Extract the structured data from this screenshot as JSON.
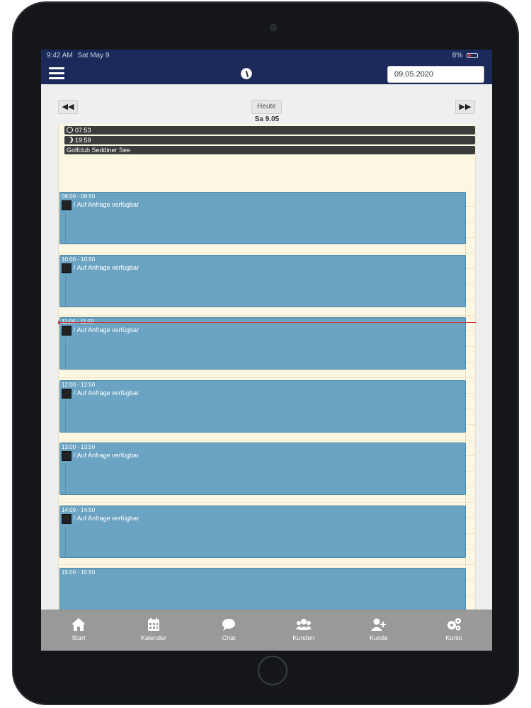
{
  "status_bar": {
    "time": "9:42 AM",
    "date": "Sat May 9",
    "battery": "8%"
  },
  "header": {
    "menu_icon": "hamburger-icon",
    "logo_icon": "golf-club-logo",
    "date_value": "09.05.2020"
  },
  "calendar": {
    "prev_label": "◀◀",
    "next_label": "▶▶",
    "today_label": "Heute",
    "day_label": "Sa 9.05",
    "sunrise": "07:53",
    "sunset": "19:59",
    "location": "Golfclub Seddiner See",
    "events": [
      {
        "time": "09:00 - 09:50",
        "title": "/ Auf Anfrage verfügbar"
      },
      {
        "time": "10:00 - 10:50",
        "title": "/ Auf Anfrage verfügbar"
      },
      {
        "time": "11:00 - 11:50",
        "title": "/ Auf Anfrage verfügbar"
      },
      {
        "time": "12:00 - 12:50",
        "title": "/ Auf Anfrage verfügbar"
      },
      {
        "time": "13:00 - 13:50",
        "title": "/ Auf Anfrage verfügbar"
      },
      {
        "time": "14:00 - 14:50",
        "title": "/ Auf Anfrage verfügbar"
      },
      {
        "time": "15:00 - 15:50",
        "title": ""
      }
    ]
  },
  "tabs": [
    {
      "label": "Start",
      "icon": "home-icon"
    },
    {
      "label": "Kalender",
      "icon": "calendar-icon"
    },
    {
      "label": "Chat",
      "icon": "chat-icon"
    },
    {
      "label": "Kunden",
      "icon": "users-icon"
    },
    {
      "label": "Kunde",
      "icon": "user-plus-icon"
    },
    {
      "label": "Konto",
      "icon": "cogs-icon"
    }
  ],
  "colors": {
    "navbar": "#1b2a5b",
    "event": "#6ba3c2",
    "grid": "#fbf7e3",
    "tab_bar": "#999999",
    "now_line": "#d43a3a"
  }
}
